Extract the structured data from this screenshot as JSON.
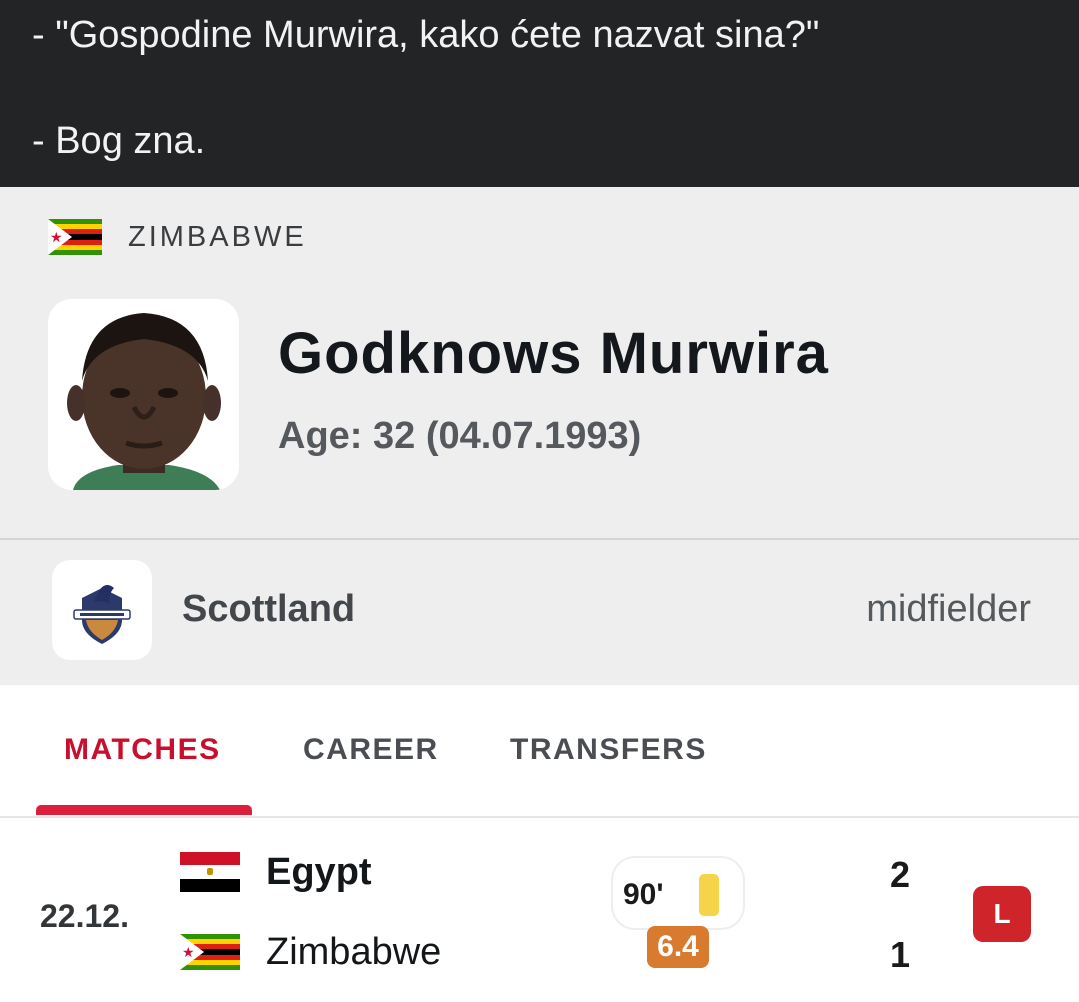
{
  "caption": {
    "line1": "- \"Gospodine Murwira, kako ćete nazvat sina?\"",
    "line2": "- Bog zna."
  },
  "header": {
    "country": "ZIMBABWE",
    "country_flag_icon": "zimbabwe-flag-icon",
    "player_name": "Godknows Murwira",
    "age_text": "Age: 32 (04.07.1993)"
  },
  "team": {
    "name": "Scottland",
    "position": "midfielder",
    "logo_icon": "scottland-crest-icon"
  },
  "tabs": [
    {
      "label": "MATCHES",
      "active": true
    },
    {
      "label": "CAREER",
      "active": false
    },
    {
      "label": "TRANSFERS",
      "active": false
    }
  ],
  "match": {
    "date": "22.12.",
    "home": {
      "name": "Egypt",
      "score": "2",
      "flag_icon": "egypt-flag-icon"
    },
    "away": {
      "name": "Zimbabwe",
      "score": "1",
      "flag_icon": "zimbabwe-flag-icon"
    },
    "minutes": "90'",
    "rating": "6.4",
    "result": "L"
  },
  "colors": {
    "accent": "#c8102e",
    "rating": "#d87b2e",
    "loss": "#d0242b",
    "yellow_card": "#f6d44a"
  }
}
